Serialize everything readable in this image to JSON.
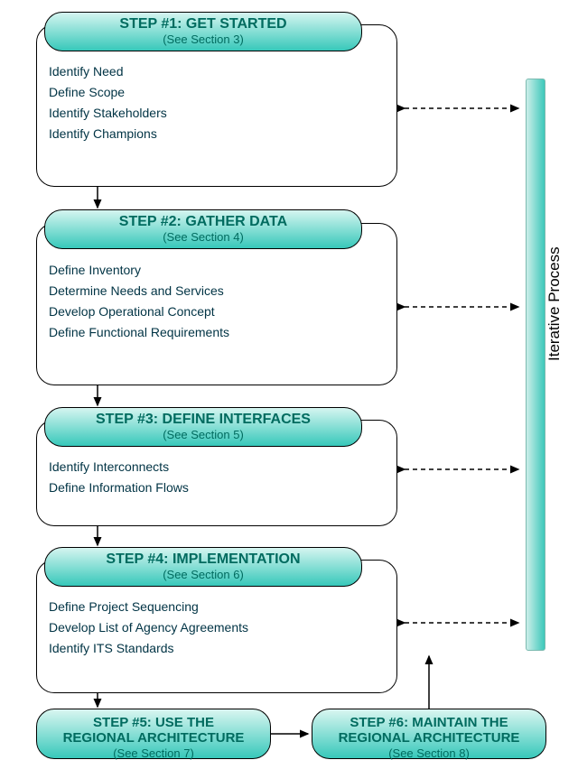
{
  "steps": [
    {
      "title": "STEP #1:  GET STARTED",
      "sub": "(See Section 3)",
      "tasks": [
        "Identify Need",
        "Define Scope",
        "Identify Stakeholders",
        "Identify Champions"
      ]
    },
    {
      "title": "STEP #2:  GATHER DATA",
      "sub": "(See Section 4)",
      "tasks": [
        "Define Inventory",
        "Determine Needs and Services",
        "Develop Operational Concept",
        "Define Functional Requirements"
      ]
    },
    {
      "title": "STEP #3:  DEFINE INTERFACES",
      "sub": "(See Section 5)",
      "tasks": [
        "Identify Interconnects",
        "Define Information Flows"
      ]
    },
    {
      "title": "STEP #4:  IMPLEMENTATION",
      "sub": "(See Section 6)",
      "tasks": [
        "Define Project Sequencing",
        "Develop List of Agency Agreements",
        "Identify ITS Standards"
      ]
    }
  ],
  "step5": {
    "title1": "STEP #5:  USE THE",
    "title2": "REGIONAL ARCHITECTURE",
    "sub": "(See Section 7)"
  },
  "step6": {
    "title1": "STEP #6:  MAINTAIN THE",
    "title2": "REGIONAL ARCHITECTURE",
    "sub": "(See Section 8)"
  },
  "iterLabel": "Iterative Process"
}
